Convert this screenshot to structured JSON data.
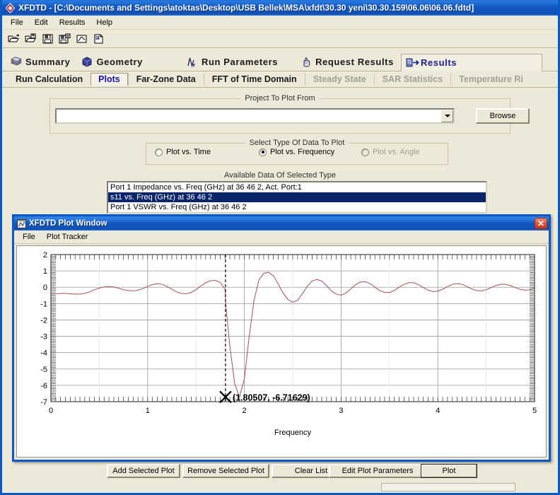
{
  "window": {
    "title": "XFDTD - [C:\\Documents and Settings\\atoktas\\Desktop\\USB Bellek\\MSA\\xfdt\\30.30 yeni\\30.30.159\\06.06\\06.06.fdtd]",
    "icon": "xfdtd-diamond-icon"
  },
  "menu": [
    {
      "label": "File"
    },
    {
      "label": "Edit"
    },
    {
      "label": "Results"
    },
    {
      "label": "Help"
    }
  ],
  "toolbar": [
    {
      "name": "open-project-icon"
    },
    {
      "name": "open-save-project-icon"
    },
    {
      "name": "save-icon"
    },
    {
      "name": "save-as-icon"
    },
    {
      "name": "plot-data-icon"
    },
    {
      "name": "copy-document-icon"
    }
  ],
  "icon_tabs": [
    {
      "label": "Summary",
      "icon": "summary-layers-icon",
      "active": false
    },
    {
      "label": "Geometry",
      "icon": "geometry-cube-icon",
      "active": false
    },
    {
      "label": "Run Parameters",
      "icon": "waveform-icon",
      "active": false
    },
    {
      "label": "Request Results",
      "icon": "hand-pointer-icon",
      "active": false
    },
    {
      "label": "Results",
      "icon": "results-arrow-icon",
      "active": true
    }
  ],
  "sub_tabs": [
    {
      "label": "Run Calculation",
      "active": false,
      "disabled": false
    },
    {
      "label": "Plots",
      "active": true,
      "disabled": false
    },
    {
      "label": "Far-Zone Data",
      "active": false,
      "disabled": false
    },
    {
      "label": "FFT of Time Domain",
      "active": false,
      "disabled": false
    },
    {
      "label": "Steady State",
      "active": false,
      "disabled": true
    },
    {
      "label": "SAR Statistics",
      "active": false,
      "disabled": true
    },
    {
      "label": "Temperature Ri",
      "active": false,
      "disabled": true
    }
  ],
  "project_group": {
    "legend": "Project To Plot From",
    "combo_value": "",
    "combo_placeholder": "",
    "browse_label": "Browse"
  },
  "data_type_group": {
    "legend": "Select Type Of Data To Plot",
    "options": [
      {
        "label": "Plot vs. Time",
        "selected": false,
        "disabled": false
      },
      {
        "label": "Plot vs. Frequency",
        "selected": true,
        "disabled": false
      },
      {
        "label": "Plot vs. Angle",
        "selected": false,
        "disabled": true
      }
    ]
  },
  "available_data": {
    "legend": "Available Data Of Selected Type",
    "items": [
      {
        "label": "Port 1 Impedance vs. Freq (GHz) at 36 46 2, Act. Port:1",
        "selected": false
      },
      {
        "label": "s11 vs. Freq (GHz) at 36 46 2",
        "selected": true
      },
      {
        "label": "Port 1 VSWR vs. Freq (GHz) at 36 46 2",
        "selected": false
      }
    ]
  },
  "bottom_buttons": [
    {
      "label": "Add Selected Plot",
      "default": false
    },
    {
      "label": "Remove Selected Plot",
      "default": false
    },
    {
      "label": "Clear List",
      "default": false
    },
    {
      "label": "Edit Plot Parameters",
      "default": false
    },
    {
      "label": "Plot",
      "default": true
    }
  ],
  "plot_window": {
    "title": "XFDTD Plot Window",
    "icon": "plot-window-icon",
    "close_label": "✕",
    "menu": [
      {
        "label": "File"
      },
      {
        "label": "Plot Tracker"
      }
    ],
    "marker_label": "(1.80507, -6.71629)"
  },
  "chart_data": {
    "type": "line",
    "title": "",
    "xlabel": "Frequency",
    "ylabel": "",
    "xlim": [
      0,
      5
    ],
    "ylim": [
      -7,
      2
    ],
    "xticks": [
      0,
      1,
      2,
      3,
      4,
      5
    ],
    "yticks": [
      2,
      1,
      0,
      -1,
      -2,
      -3,
      -4,
      -5,
      -6,
      -7
    ],
    "grid": true,
    "legend": "none",
    "line_color": "#a85050",
    "marker": {
      "x": 1.80507,
      "y": -6.71629,
      "label": "(1.80507, -6.71629)",
      "style": "x-cross-with-dashed-vline"
    },
    "series": [
      {
        "name": "s11 vs. Freq (GHz) at 36 46 2",
        "x": [
          0.0,
          0.05,
          0.1,
          0.15,
          0.2,
          0.25,
          0.3,
          0.35,
          0.4,
          0.45,
          0.5,
          0.55,
          0.6,
          0.65,
          0.7,
          0.75,
          0.8,
          0.85,
          0.9,
          0.95,
          1.0,
          1.05,
          1.1,
          1.15,
          1.2,
          1.25,
          1.3,
          1.35,
          1.4,
          1.45,
          1.5,
          1.55,
          1.6,
          1.65,
          1.7,
          1.75,
          1.8,
          1.81,
          1.85,
          1.9,
          1.95,
          2.0,
          2.05,
          2.1,
          2.15,
          2.2,
          2.25,
          2.3,
          2.35,
          2.4,
          2.45,
          2.5,
          2.55,
          2.6,
          2.65,
          2.7,
          2.75,
          2.8,
          2.85,
          2.9,
          2.95,
          3.0,
          3.05,
          3.1,
          3.15,
          3.2,
          3.25,
          3.3,
          3.35,
          3.4,
          3.45,
          3.5,
          3.55,
          3.6,
          3.65,
          3.7,
          3.75,
          3.8,
          3.85,
          3.9,
          3.95,
          4.0,
          4.05,
          4.1,
          4.15,
          4.2,
          4.25,
          4.3,
          4.35,
          4.4,
          4.45,
          4.5,
          4.55,
          4.6,
          4.65,
          4.7,
          4.75,
          4.8,
          4.85,
          4.9,
          4.95,
          5.0
        ],
        "y": [
          -0.42,
          -0.4,
          -0.38,
          -0.38,
          -0.4,
          -0.42,
          -0.42,
          -0.38,
          -0.28,
          -0.15,
          -0.05,
          0.02,
          0.05,
          0.02,
          -0.06,
          -0.15,
          -0.2,
          -0.22,
          -0.18,
          -0.08,
          0.05,
          0.16,
          0.22,
          0.18,
          0.05,
          -0.12,
          -0.28,
          -0.38,
          -0.4,
          -0.32,
          -0.15,
          0.08,
          0.28,
          0.4,
          0.42,
          0.3,
          -0.1,
          -1.2,
          -3.6,
          -5.9,
          -6.72,
          -5.6,
          -3.0,
          -0.8,
          0.45,
          0.85,
          0.92,
          0.7,
          0.2,
          -0.35,
          -0.75,
          -0.92,
          -0.8,
          -0.4,
          0.05,
          0.38,
          0.48,
          0.38,
          0.1,
          -0.22,
          -0.42,
          -0.48,
          -0.36,
          -0.1,
          0.16,
          0.32,
          0.34,
          0.22,
          0.0,
          -0.2,
          -0.32,
          -0.32,
          -0.2,
          0.0,
          0.18,
          0.28,
          0.28,
          0.16,
          -0.02,
          -0.18,
          -0.26,
          -0.24,
          -0.12,
          0.04,
          0.18,
          0.22,
          0.18,
          0.05,
          -0.1,
          -0.2,
          -0.22,
          -0.15,
          -0.02,
          0.1,
          0.18,
          0.18,
          0.1,
          -0.02,
          -0.12,
          -0.18,
          -0.15,
          -0.05,
          0.05
        ]
      }
    ]
  }
}
